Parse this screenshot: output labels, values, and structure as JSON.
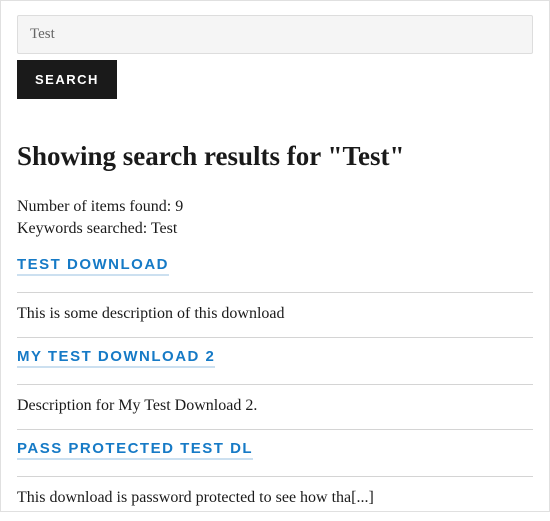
{
  "search": {
    "value": "Test",
    "button_label": "SEARCH"
  },
  "results": {
    "heading": "Showing search results for \"Test\"",
    "count_label": "Number of items found: 9",
    "keywords_label": "Keywords searched: Test",
    "items": [
      {
        "title": "TEST DOWNLOAD",
        "description": "This is some description of this download"
      },
      {
        "title": "MY TEST DOWNLOAD 2",
        "description": "Description for My Test Download 2."
      },
      {
        "title": "PASS PROTECTED TEST DL",
        "description": "This download is password protected to see how tha[...]"
      }
    ]
  }
}
